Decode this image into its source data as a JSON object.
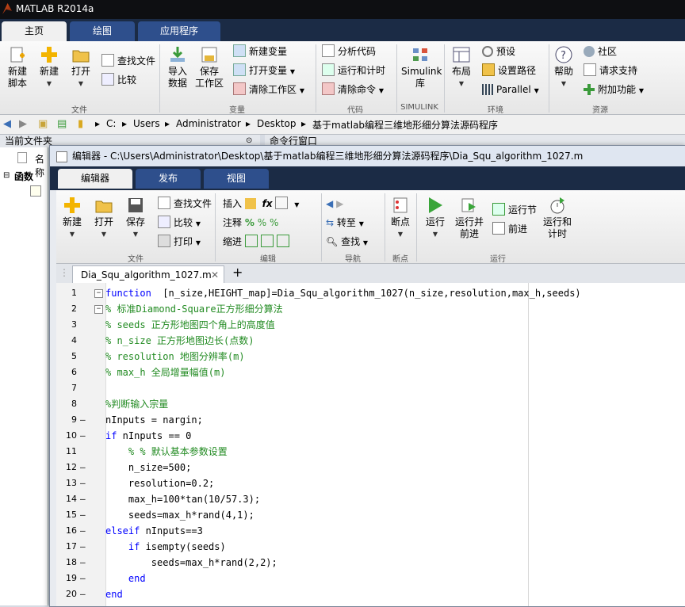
{
  "window": {
    "title": "MATLAB R2014a"
  },
  "main_tabs": [
    "主页",
    "绘图",
    "应用程序"
  ],
  "main_ribbon": {
    "new_script": "新建\n脚本",
    "new": "新建",
    "open": "打开",
    "find_files": "查找文件",
    "compare": "比较",
    "import_data": "导入\n数据",
    "save_workspace": "保存\n工作区",
    "new_variable": "新建变量",
    "open_variable": "打开变量",
    "clear_workspace": "清除工作区",
    "analyze_code": "分析代码",
    "run_and_time": "运行和计时",
    "clear_commands": "清除命令",
    "simulink_library": "Simulink\n库",
    "layout": "布局",
    "preferences": "预设",
    "set_path": "设置路径",
    "parallel": "Parallel",
    "help": "帮助",
    "community": "社区",
    "request_support": "请求支持",
    "add_ons": "附加功能",
    "groups": [
      "文件",
      "变量",
      "代码",
      "SIMULINK",
      "环境",
      "资源"
    ]
  },
  "address": {
    "crumbs": [
      "C:",
      "Users",
      "Administrator",
      "Desktop",
      "基于matlab编程三维地形细分算法源码程序"
    ]
  },
  "panes": {
    "current_folder": "当前文件夹",
    "command_window": "命令行窗口",
    "name_col": "名称",
    "functions": "函数"
  },
  "editor": {
    "title": "编辑器 - C:\\Users\\Administrator\\Desktop\\基于matlab编程三维地形细分算法源码程序\\Dia_Squ_algorithm_1027.m",
    "tabs": [
      "编辑器",
      "发布",
      "视图"
    ],
    "ribbon": {
      "new": "新建",
      "open": "打开",
      "save": "保存",
      "find_files": "查找文件",
      "compare": "比较",
      "print": "打印",
      "insert": "插入",
      "comment": "注释",
      "indent": "缩进",
      "goto": "转至",
      "find": "查找",
      "breakpoints": "断点",
      "run": "运行",
      "run_advance": "运行并\n前进",
      "run_section": "运行节",
      "advance": "前进",
      "run_time": "运行和\n计时",
      "groups": [
        "文件",
        "编辑",
        "导航",
        "断点",
        "运行"
      ]
    },
    "doc_tab": "Dia_Squ_algorithm_1027.m",
    "lines": [
      {
        "n": "1",
        "dash": "",
        "code": [
          {
            "t": "function",
            "c": "kw"
          },
          {
            "t": "  [n_size,HEIGHT_map]=Dia_Squ_algorithm_1027(n_size,resolution,max_h,seeds)",
            "c": ""
          }
        ]
      },
      {
        "n": "2",
        "dash": "",
        "code": [
          {
            "t": "% 标准Diamond-Square正方形细分算法",
            "c": "cm"
          }
        ]
      },
      {
        "n": "3",
        "dash": "",
        "code": [
          {
            "t": "% seeds 正方形地图四个角上的高度值",
            "c": "cm"
          }
        ]
      },
      {
        "n": "4",
        "dash": "",
        "code": [
          {
            "t": "% n_size 正方形地图边长(点数)",
            "c": "cm"
          }
        ]
      },
      {
        "n": "5",
        "dash": "",
        "code": [
          {
            "t": "% resolution 地图分辨率(m)",
            "c": "cm"
          }
        ]
      },
      {
        "n": "6",
        "dash": "",
        "code": [
          {
            "t": "% max_h 全局增量幅值(m)",
            "c": "cm"
          }
        ]
      },
      {
        "n": "7",
        "dash": "",
        "code": []
      },
      {
        "n": "8",
        "dash": "",
        "code": [
          {
            "t": "%判断输入宗量",
            "c": "cm"
          }
        ]
      },
      {
        "n": "9",
        "dash": "—",
        "code": [
          {
            "t": "nInputs = nargin;",
            "c": ""
          }
        ]
      },
      {
        "n": "10",
        "dash": "—",
        "code": [
          {
            "t": "if",
            "c": "kw"
          },
          {
            "t": " nInputs == 0",
            "c": ""
          }
        ]
      },
      {
        "n": "11",
        "dash": "",
        "code": [
          {
            "t": "    % % 默认基本参数设置",
            "c": "cm"
          }
        ]
      },
      {
        "n": "12",
        "dash": "—",
        "code": [
          {
            "t": "    n_size=500;",
            "c": ""
          }
        ]
      },
      {
        "n": "13",
        "dash": "—",
        "code": [
          {
            "t": "    resolution=0.2;",
            "c": ""
          }
        ]
      },
      {
        "n": "14",
        "dash": "—",
        "code": [
          {
            "t": "    max_h=100*tan(10/57.3);",
            "c": ""
          }
        ]
      },
      {
        "n": "15",
        "dash": "—",
        "code": [
          {
            "t": "    seeds=max_h*rand(4,1);",
            "c": ""
          }
        ]
      },
      {
        "n": "16",
        "dash": "—",
        "code": [
          {
            "t": "elseif",
            "c": "kw"
          },
          {
            "t": " nInputs==3",
            "c": ""
          }
        ]
      },
      {
        "n": "17",
        "dash": "—",
        "code": [
          {
            "t": "    ",
            "c": ""
          },
          {
            "t": "if",
            "c": "kw"
          },
          {
            "t": " isempty(seeds)",
            "c": ""
          }
        ]
      },
      {
        "n": "18",
        "dash": "—",
        "code": [
          {
            "t": "        seeds=max_h*rand(2,2);",
            "c": ""
          }
        ]
      },
      {
        "n": "19",
        "dash": "—",
        "code": [
          {
            "t": "    ",
            "c": ""
          },
          {
            "t": "end",
            "c": "kw"
          }
        ]
      },
      {
        "n": "20",
        "dash": "—",
        "code": [
          {
            "t": "end",
            "c": "kw"
          }
        ]
      }
    ]
  }
}
